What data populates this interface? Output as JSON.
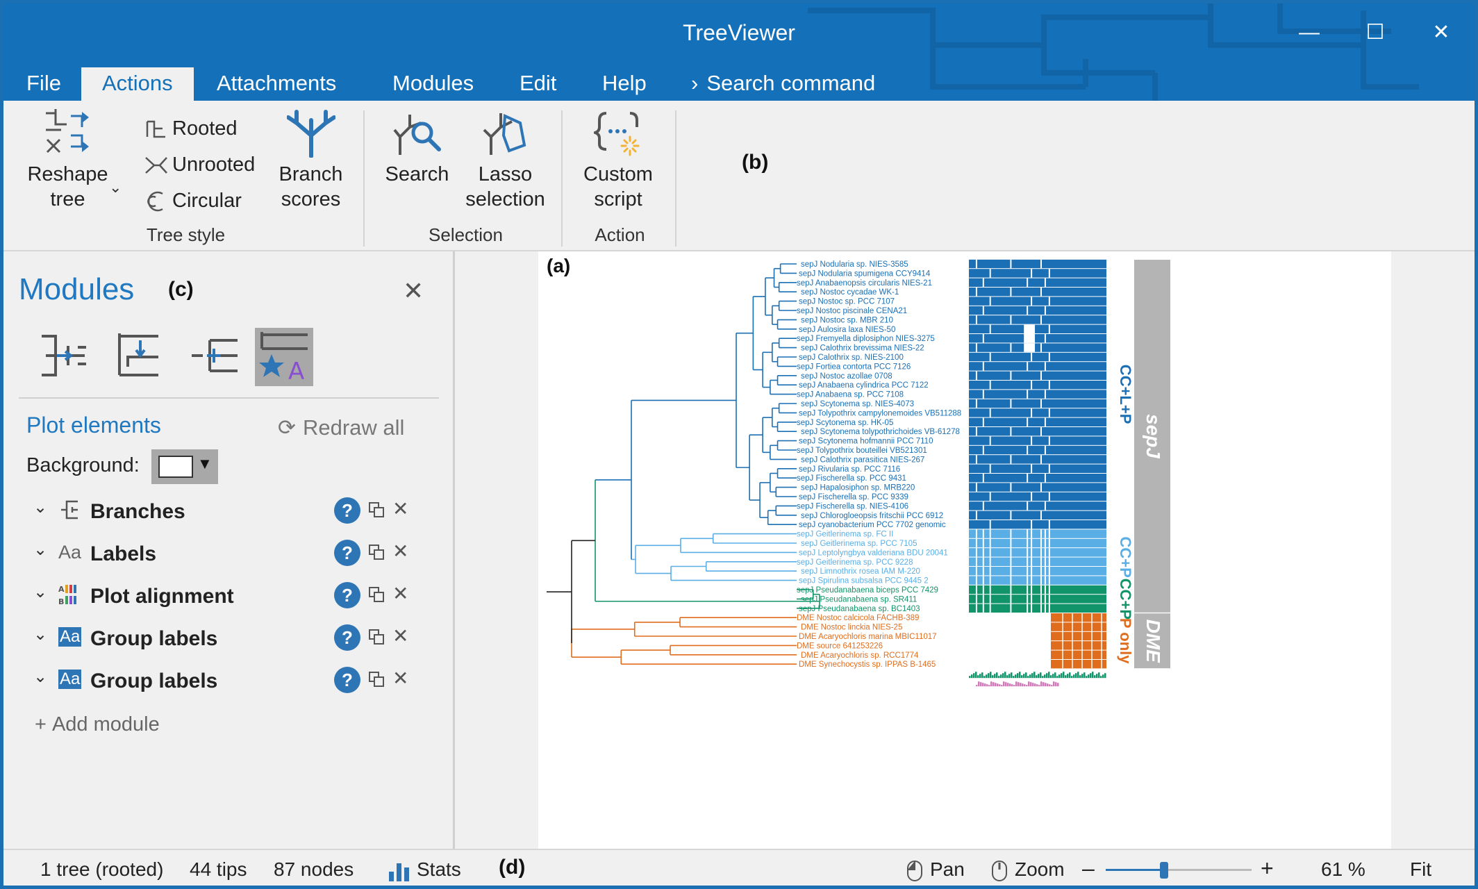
{
  "window": {
    "title": "TreeViewer",
    "minimize": "—",
    "maximize": "☐",
    "close": "✕"
  },
  "menu": {
    "items": [
      "File",
      "Actions",
      "Attachments",
      "Modules",
      "Edit",
      "Help"
    ],
    "active": "Actions",
    "search": "Search command"
  },
  "ribbon": {
    "reshape_tree": "Reshape\ntree",
    "rooted": "Rooted",
    "unrooted": "Unrooted",
    "circular": "Circular",
    "branch_scores": "Branch\nscores",
    "search": "Search",
    "lasso": "Lasso\nselection",
    "custom_script": "Custom\nscript",
    "group_tree_style": "Tree style",
    "group_selection": "Selection",
    "group_action": "Action",
    "label_b": "(b)"
  },
  "modules_panel": {
    "title": "Modules",
    "label_c": "(c)",
    "close": "✕",
    "plot_elements": "Plot elements",
    "redraw_all": "Redraw all",
    "background_label": "Background:",
    "background_color": "#ffffff",
    "modules": [
      {
        "label": "Branches",
        "icon": "branches-icon"
      },
      {
        "label": "Labels",
        "icon": "labels-icon"
      },
      {
        "label": "Plot alignment",
        "icon": "alignment-icon"
      },
      {
        "label": "Group labels",
        "icon": "group-labels-icon"
      },
      {
        "label": "Group labels",
        "icon": "group-labels-icon"
      }
    ],
    "add_module": "Add module"
  },
  "plot": {
    "label_a": "(a)",
    "colors": {
      "blue": "#1a6fb5",
      "light_blue": "#5aaee6",
      "green": "#12946a",
      "orange": "#e06d1d",
      "gray_bar": "#b4b4b4",
      "pink": "#d078b8"
    },
    "tips": [
      {
        "label": "sepJ Nodularia sp. NIES-3585",
        "clade": "blue"
      },
      {
        "label": "sepJ Nodularia spumigena CCY9414",
        "clade": "blue"
      },
      {
        "label": "sepJ Anabaenopsis circularis NIES-21",
        "clade": "blue"
      },
      {
        "label": "sepJ Nostoc cycadae WK-1",
        "clade": "blue"
      },
      {
        "label": "sepJ Nostoc sp. PCC 7107",
        "clade": "blue"
      },
      {
        "label": "sepJ Nostoc piscinale CENA21",
        "clade": "blue"
      },
      {
        "label": "sepJ Nostoc sp. MBR 210",
        "clade": "blue"
      },
      {
        "label": "sepJ Aulosira laxa NIES-50",
        "clade": "blue"
      },
      {
        "label": "sepJ Fremyella diplosiphon NIES-3275",
        "clade": "blue"
      },
      {
        "label": "sepJ Calothrix brevissima NIES-22",
        "clade": "blue"
      },
      {
        "label": "sepJ Calothrix sp. NIES-2100",
        "clade": "blue"
      },
      {
        "label": "sepJ Fortiea contorta PCC 7126",
        "clade": "blue"
      },
      {
        "label": "sepJ Nostoc azollae 0708",
        "clade": "blue"
      },
      {
        "label": "sepJ Anabaena cylindrica PCC 7122",
        "clade": "blue"
      },
      {
        "label": "sepJ Anabaena sp. PCC 7108",
        "clade": "blue"
      },
      {
        "label": "sepJ Scytonema sp. NIES-4073",
        "clade": "blue"
      },
      {
        "label": "sepJ Tolypothrix campylonemoides VB511288",
        "clade": "blue"
      },
      {
        "label": "sepJ Scytonema sp. HK-05",
        "clade": "blue"
      },
      {
        "label": "sepJ Scytonema tolypothrichoides VB-61278",
        "clade": "blue"
      },
      {
        "label": "sepJ Scytonema hofmannii PCC 7110",
        "clade": "blue"
      },
      {
        "label": "sepJ Tolypothrix bouteillei VB521301",
        "clade": "blue"
      },
      {
        "label": "sepJ Calothrix parasitica NIES-267",
        "clade": "blue"
      },
      {
        "label": "sepJ Rivularia sp. PCC 7116",
        "clade": "blue"
      },
      {
        "label": "sepJ Fischerella sp. PCC 9431",
        "clade": "blue"
      },
      {
        "label": "sepJ Hapalosiphon sp. MRB220",
        "clade": "blue"
      },
      {
        "label": "sepJ Fischerella sp. PCC 9339",
        "clade": "blue"
      },
      {
        "label": "sepJ Fischerella sp. NIES-4106",
        "clade": "blue"
      },
      {
        "label": "sepJ Chlorogloeopsis fritschii PCC 6912",
        "clade": "blue"
      },
      {
        "label": "sepJ cyanobacterium PCC 7702 genomic",
        "clade": "blue"
      },
      {
        "label": "sepJ Geitlerinema sp. FC II",
        "clade": "light_blue"
      },
      {
        "label": "sepJ Geitlerinema sp. PCC 7105",
        "clade": "light_blue"
      },
      {
        "label": "sepJ Leptolyngbya valderiana BDU 20041",
        "clade": "light_blue"
      },
      {
        "label": "sepJ Geitlerinema sp. PCC 9228",
        "clade": "light_blue"
      },
      {
        "label": "sepJ Limnothrix rosea IAM M-220",
        "clade": "light_blue"
      },
      {
        "label": "sepJ Spirulina subsalsa PCC 9445 2",
        "clade": "light_blue"
      },
      {
        "label": "sepJ Pseudanabaena biceps PCC 7429",
        "clade": "green"
      },
      {
        "label": "sepJ Pseudanabaena sp. SR411",
        "clade": "green"
      },
      {
        "label": "sepJ Pseudanabaena sp. BC1403",
        "clade": "green"
      },
      {
        "label": "DME Nostoc calcicola FACHB-389",
        "clade": "orange"
      },
      {
        "label": "DME Nostoc linckia NIES-25",
        "clade": "orange"
      },
      {
        "label": "DME Acaryochloris marina MBIC11017",
        "clade": "orange"
      },
      {
        "label": "DME source 641253226",
        "clade": "orange"
      },
      {
        "label": "DME Acaryochloris sp. RCC1774",
        "clade": "orange"
      },
      {
        "label": "DME Synechocystis sp. IPPAS B-1465",
        "clade": "orange"
      }
    ],
    "group_labels": [
      {
        "text": "CC+L+P",
        "clade": "blue"
      },
      {
        "text": "CC+P",
        "clade": "light_blue"
      },
      {
        "text": "CC+P",
        "clade": "green"
      },
      {
        "text": "P only",
        "clade": "orange"
      }
    ],
    "outer_groups": [
      "sepJ",
      "DME"
    ]
  },
  "status": {
    "trees": "1 tree (rooted)",
    "tips": "44 tips",
    "nodes": "87 nodes",
    "stats": "Stats",
    "label_d": "(d)",
    "pan": "Pan",
    "zoom": "Zoom",
    "zoom_minus": "–",
    "zoom_plus": "+",
    "zoom_fraction": 0.4,
    "zoom_level": "61 %",
    "fit": "Fit"
  }
}
